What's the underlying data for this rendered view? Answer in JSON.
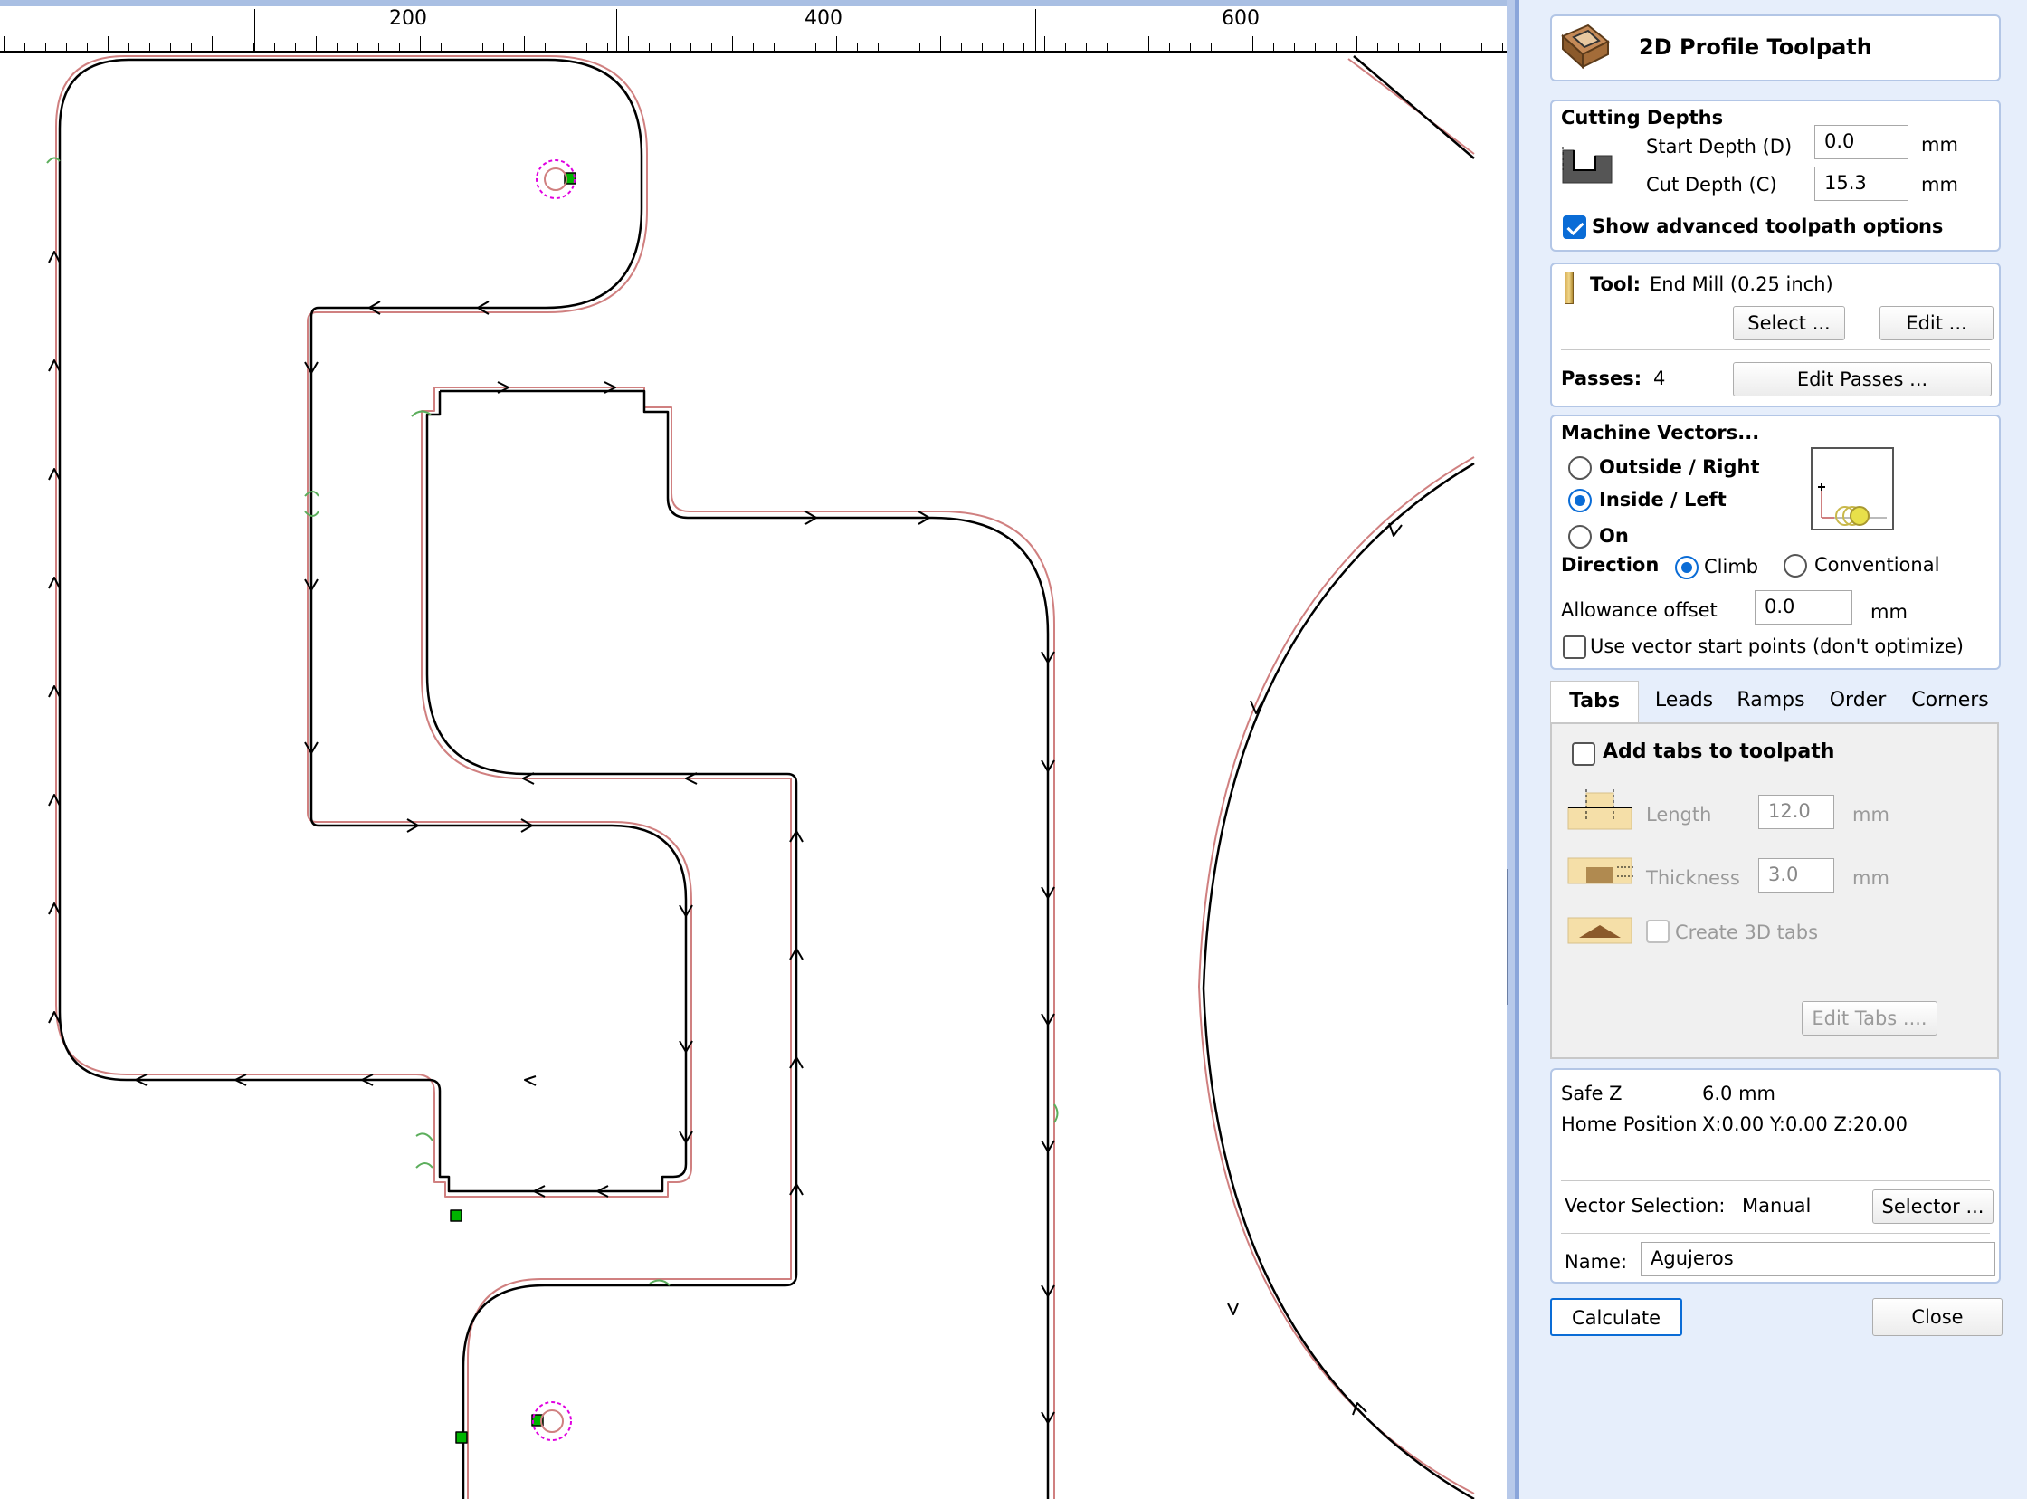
{
  "ruler": {
    "labels": [
      "200",
      "400",
      "600"
    ]
  },
  "panel": {
    "title": "2D Profile Toolpath",
    "cutting_depths": {
      "heading": "Cutting Depths",
      "start_label": "Start Depth (D)",
      "start_value": "0.0",
      "cut_label": "Cut Depth (C)",
      "cut_value": "15.3",
      "unit": "mm",
      "advanced_label": "Show advanced toolpath options",
      "advanced_checked": true
    },
    "tool": {
      "label": "Tool:",
      "value": "End Mill (0.25 inch)",
      "select_btn": "Select ...",
      "edit_btn": "Edit ...",
      "passes_label": "Passes:",
      "passes_value": "4",
      "edit_passes_btn": "Edit Passes ..."
    },
    "machine": {
      "heading": "Machine Vectors...",
      "outside": "Outside / Right",
      "inside": "Inside / Left",
      "on": "On",
      "selected": "Inside / Left",
      "direction_label": "Direction",
      "climb": "Climb",
      "conventional": "Conventional",
      "direction_selected": "Climb",
      "allowance_label": "Allowance offset",
      "allowance_value": "0.0",
      "allowance_unit": "mm",
      "vector_start_label": "Use vector start points (don't optimize)"
    },
    "tabs": {
      "items": [
        "Tabs",
        "Leads",
        "Ramps",
        "Order",
        "Corners"
      ],
      "active": "Tabs",
      "add_tabs_label": "Add tabs to toolpath",
      "length_label": "Length",
      "length_value": "12.0",
      "thickness_label": "Thickness",
      "thickness_value": "3.0",
      "unit": "mm",
      "create_3d_label": "Create 3D tabs",
      "edit_tabs_btn": "Edit Tabs ...."
    },
    "info": {
      "safe_z_label": "Safe Z",
      "safe_z_value": "6.0 mm",
      "home_label": "Home Position",
      "home_value": "X:0.00 Y:0.00 Z:20.00",
      "vector_sel_label": "Vector Selection:",
      "vector_sel_value": "Manual",
      "selector_btn": "Selector ...",
      "name_label": "Name:",
      "name_value": "Agujeros"
    },
    "calculate_btn": "Calculate",
    "close_btn": "Close"
  },
  "colors": {
    "accent": "#0a6cd6",
    "vector_line": "#000000",
    "toolpath_line": "#d08080",
    "node_green": "#00b400",
    "tab_marker": "#e000e0",
    "panel_bg": "#e6eefb"
  }
}
